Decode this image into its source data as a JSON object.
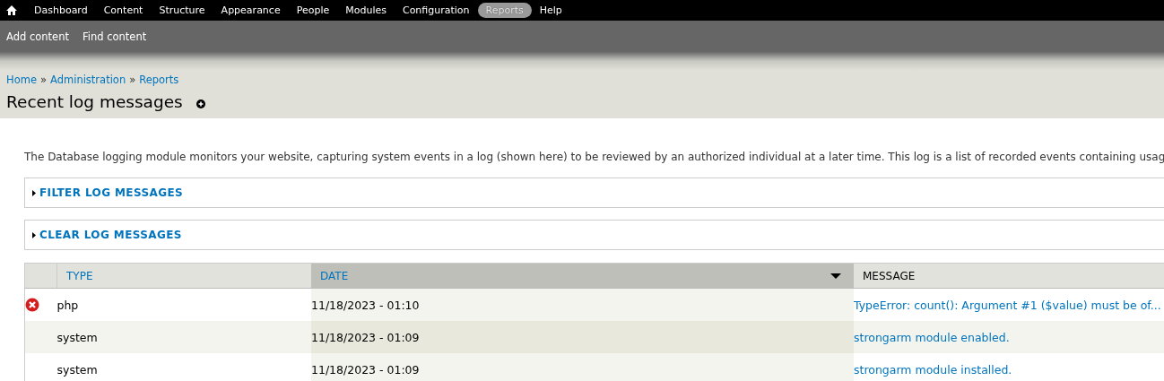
{
  "toolbar": {
    "items": [
      {
        "label": "Dashboard",
        "selected": false
      },
      {
        "label": "Content",
        "selected": false
      },
      {
        "label": "Structure",
        "selected": false
      },
      {
        "label": "Appearance",
        "selected": false
      },
      {
        "label": "People",
        "selected": false
      },
      {
        "label": "Modules",
        "selected": false
      },
      {
        "label": "Configuration",
        "selected": false
      },
      {
        "label": "Reports",
        "selected": true
      },
      {
        "label": "Help",
        "selected": false
      }
    ]
  },
  "shortcuts": [
    "Add content",
    "Find content"
  ],
  "breadcrumb": [
    "Home",
    "Administration",
    "Reports"
  ],
  "breadcrumb_separator": "»",
  "page_title": "Recent log messages",
  "description": "The Database logging module monitors your website, capturing system events in a log (shown here) to be reviewed by an authorized individual at a later time. This log is a list of recorded events containing usag",
  "fieldsets": [
    {
      "label": "FILTER LOG MESSAGES",
      "expanded": false
    },
    {
      "label": "CLEAR LOG MESSAGES",
      "expanded": false
    }
  ],
  "table": {
    "columns": [
      {
        "label": "TYPE",
        "sortable": true,
        "sorted": false
      },
      {
        "label": "DATE",
        "sortable": true,
        "sorted": true
      },
      {
        "label": "MESSAGE",
        "sortable": false,
        "sorted": false
      }
    ],
    "rows": [
      {
        "kind": "error",
        "type": "php",
        "date": "11/18/2023 - 01:10",
        "message": "TypeError: count(): Argument #1 ($value) must be of..."
      },
      {
        "kind": "plain",
        "type": "system",
        "date": "11/18/2023 - 01:09",
        "message": "strongarm module enabled."
      },
      {
        "kind": "plain",
        "type": "system",
        "date": "11/18/2023 - 01:09",
        "message": "strongarm module installed."
      }
    ]
  }
}
